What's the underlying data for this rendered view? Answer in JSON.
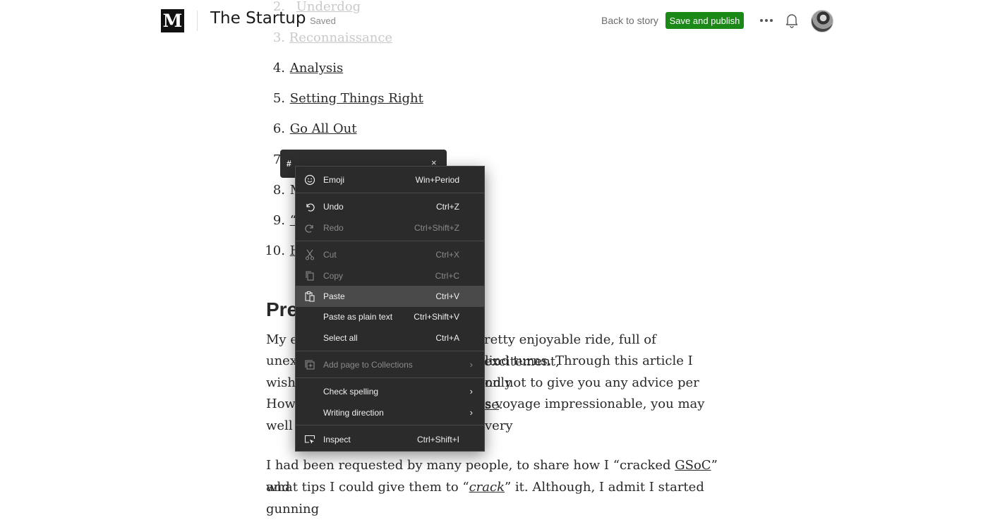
{
  "header": {
    "logo_letter": "M",
    "publication": "The Startup",
    "status": "Saved",
    "back_link": "Back to story",
    "publish_button": "Save and publish",
    "accent_color": "#1a8917"
  },
  "article": {
    "toc": [
      {
        "num": "2.",
        "label": "Underdog"
      },
      {
        "num": "3.",
        "label": "Reconnaissance"
      },
      {
        "num": "4.",
        "label": "Analysis"
      },
      {
        "num": "5.",
        "label": "Setting Things Right"
      },
      {
        "num": "6.",
        "label": "Go All Out"
      },
      {
        "num": "7.",
        "label": ""
      },
      {
        "num": "8.",
        "label": "M"
      },
      {
        "num": "9.",
        "label": "“V"
      },
      {
        "num": "10.",
        "label": "H"
      }
    ],
    "heading": "Pre",
    "para1": [
      {
        "left": "My e",
        "right": "retty enjoyable ride, full of excitement,"
      },
      {
        "left": "unex",
        "right": "lind turns. Through this article I only"
      },
      {
        "left": "wish",
        "right": "nd not to give you any advice per ",
        "link": "se",
        "end": "."
      },
      {
        "left": "How",
        "right": "s voyage impressionable, you may very"
      },
      {
        "left": "well",
        "right": ""
      }
    ],
    "para2": {
      "line1_a": "I had been requested by many people, to share how I “cracked ",
      "line1_link": "GSoC",
      "line1_b": "” and",
      "line2_a": "what tips I could give them to “",
      "line2_em": "crack",
      "line2_b": "” it. Although, I admit I started gunning"
    }
  },
  "highlight_toolbar": {
    "hash": "#",
    "close": "×"
  },
  "context_menu": {
    "items": [
      {
        "label": "Emoji",
        "shortcut": "Win+Period",
        "icon": "emoji-icon",
        "disabled": false
      },
      {
        "label": "Undo",
        "shortcut": "Ctrl+Z",
        "icon": "undo-icon",
        "disabled": false
      },
      {
        "label": "Redo",
        "shortcut": "Ctrl+Shift+Z",
        "icon": "redo-icon",
        "disabled": true
      },
      {
        "label": "Cut",
        "shortcut": "Ctrl+X",
        "icon": "cut-icon",
        "disabled": true
      },
      {
        "label": "Copy",
        "shortcut": "Ctrl+C",
        "icon": "copy-icon",
        "disabled": true
      },
      {
        "label": "Paste",
        "shortcut": "Ctrl+V",
        "icon": "paste-icon",
        "disabled": false,
        "hover": true
      },
      {
        "label": "Paste as plain text",
        "shortcut": "Ctrl+Shift+V",
        "icon": "",
        "disabled": false
      },
      {
        "label": "Select all",
        "shortcut": "Ctrl+A",
        "icon": "",
        "disabled": false
      },
      {
        "label": "Add page to Collections",
        "shortcut": "",
        "icon": "collections-icon",
        "disabled": true,
        "submenu": true
      },
      {
        "label": "Check spelling",
        "shortcut": "",
        "icon": "",
        "disabled": false,
        "submenu": true
      },
      {
        "label": "Writing direction",
        "shortcut": "",
        "icon": "",
        "disabled": false,
        "submenu": true
      },
      {
        "label": "Inspect",
        "shortcut": "Ctrl+Shift+I",
        "icon": "inspect-icon",
        "disabled": false
      }
    ],
    "submenu_arrow": "›"
  }
}
